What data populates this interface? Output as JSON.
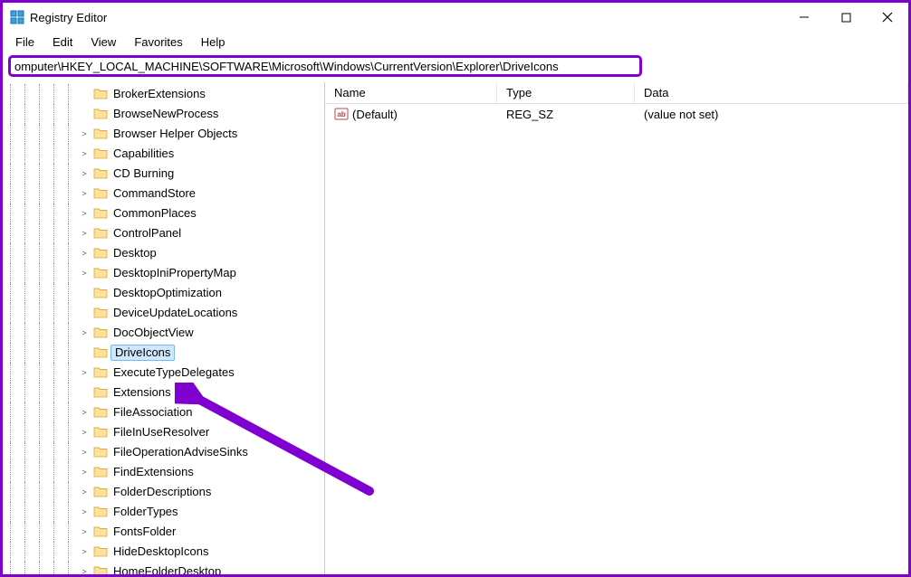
{
  "window": {
    "title": "Registry Editor"
  },
  "menu": {
    "file": "File",
    "edit": "Edit",
    "view": "View",
    "favorites": "Favorites",
    "help": "Help"
  },
  "address": {
    "path": "omputer\\HKEY_LOCAL_MACHINE\\SOFTWARE\\Microsoft\\Windows\\CurrentVersion\\Explorer\\DriveIcons"
  },
  "columns": {
    "name": "Name",
    "type": "Type",
    "data": "Data"
  },
  "values": [
    {
      "name": "(Default)",
      "type": "REG_SZ",
      "data": "(value not set)"
    }
  ],
  "tree": [
    {
      "expander": "",
      "label": "BrokerExtensions",
      "selected": false
    },
    {
      "expander": "",
      "label": "BrowseNewProcess",
      "selected": false
    },
    {
      "expander": ">",
      "label": "Browser Helper Objects",
      "selected": false
    },
    {
      "expander": ">",
      "label": "Capabilities",
      "selected": false
    },
    {
      "expander": ">",
      "label": "CD Burning",
      "selected": false
    },
    {
      "expander": ">",
      "label": "CommandStore",
      "selected": false
    },
    {
      "expander": ">",
      "label": "CommonPlaces",
      "selected": false
    },
    {
      "expander": ">",
      "label": "ControlPanel",
      "selected": false
    },
    {
      "expander": ">",
      "label": "Desktop",
      "selected": false
    },
    {
      "expander": ">",
      "label": "DesktopIniPropertyMap",
      "selected": false
    },
    {
      "expander": "",
      "label": "DesktopOptimization",
      "selected": false
    },
    {
      "expander": "",
      "label": "DeviceUpdateLocations",
      "selected": false
    },
    {
      "expander": ">",
      "label": "DocObjectView",
      "selected": false
    },
    {
      "expander": "",
      "label": "DriveIcons",
      "selected": true
    },
    {
      "expander": ">",
      "label": "ExecuteTypeDelegates",
      "selected": false
    },
    {
      "expander": "",
      "label": "Extensions",
      "selected": false
    },
    {
      "expander": ">",
      "label": "FileAssociation",
      "selected": false
    },
    {
      "expander": ">",
      "label": "FileInUseResolver",
      "selected": false
    },
    {
      "expander": ">",
      "label": "FileOperationAdviseSinks",
      "selected": false
    },
    {
      "expander": ">",
      "label": "FindExtensions",
      "selected": false
    },
    {
      "expander": ">",
      "label": "FolderDescriptions",
      "selected": false
    },
    {
      "expander": ">",
      "label": "FolderTypes",
      "selected": false
    },
    {
      "expander": ">",
      "label": "FontsFolder",
      "selected": false
    },
    {
      "expander": ">",
      "label": "HideDesktopIcons",
      "selected": false
    },
    {
      "expander": ">",
      "label": "HomeFolderDesktop",
      "selected": false
    }
  ]
}
